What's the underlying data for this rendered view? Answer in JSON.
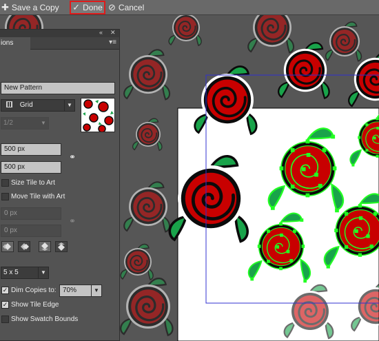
{
  "toolbar": {
    "save_copy": "Save a Copy",
    "done": "Done",
    "cancel": "Cancel",
    "save_icon": "plus-icon",
    "done_icon": "checkmark-icon",
    "cancel_icon": "cancel-icon"
  },
  "panel": {
    "tab_label": "ions",
    "name_value": "New Pattern",
    "tile_type": "Grid",
    "brick_offset": "1/2",
    "width_value": "500 px",
    "height_value": "500 px",
    "size_tile_to_art": "Size Tile to Art",
    "move_tile_with_art": "Move Tile with Art",
    "h_spacing": "0 px",
    "v_spacing": "0 px",
    "copies": "5 x 5",
    "dim_copies_label": "Dim Copies to:",
    "dim_copies_value": "70%",
    "show_tile_edge": "Show Tile Edge",
    "show_swatch_bounds": "Show Swatch Bounds",
    "checked": {
      "size_tile_to_art": false,
      "move_tile_with_art": false,
      "dim_copies": true,
      "show_tile_edge": true,
      "show_swatch_bounds": false
    }
  },
  "colors": {
    "rose_red": "#c80000",
    "leaf_green": "#19a34a",
    "tile_edge": "#3030d0",
    "selection": "#22ff22",
    "highlight_border": "#e01a1a"
  }
}
